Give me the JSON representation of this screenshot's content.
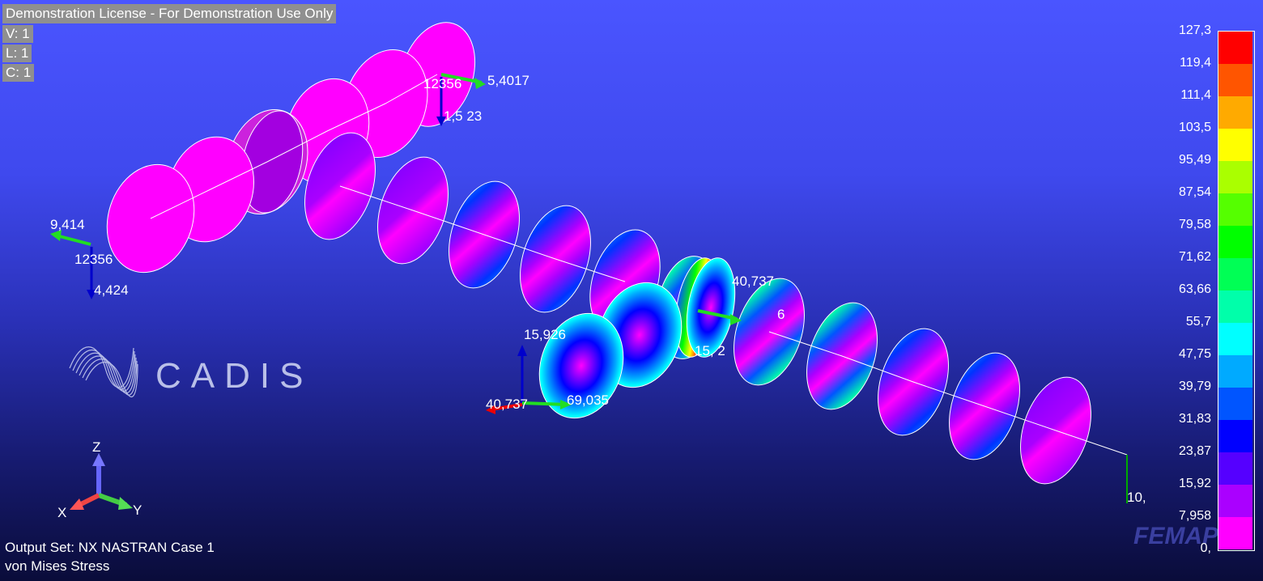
{
  "license": {
    "text": "Demonstration License - For Demonstration Use Only",
    "view": "V: 1",
    "layer": "L: 1",
    "color": "C: 1"
  },
  "output": {
    "set": "Output Set: NX NASTRAN Case 1",
    "quantity": "von Mises Stress"
  },
  "legend": {
    "labels": [
      "127,3",
      "119,4",
      "111,4",
      "103,5",
      "95,49",
      "87,54",
      "79,58",
      "71,62",
      "63,66",
      "55,7",
      "47,75",
      "39,79",
      "31,83",
      "23,87",
      "15,92",
      "7,958",
      "0,"
    ],
    "colors": [
      "#ff0000",
      "#ff5500",
      "#ffaa00",
      "#ffff00",
      "#aaff00",
      "#55ff00",
      "#00ff00",
      "#00ff55",
      "#00ffaa",
      "#00ffff",
      "#00aaff",
      "#0055ff",
      "#0000ff",
      "#5500ff",
      "#aa00ff",
      "#ff00ff"
    ]
  },
  "axes": {
    "z": "Z",
    "x": "X",
    "y": "Y"
  },
  "watermark": {
    "cadis": "CADIS",
    "femap": "FEMAP"
  },
  "scene_labels": {
    "node_top": "12356",
    "load_top": "5,4017",
    "load_top_2": "1,5 23",
    "load_left": "9,414",
    "node_left": "12356",
    "load_left_2": "4,424",
    "load_mid_1": "40,737",
    "load_mid_2": "15,926",
    "load_mid_3": "40,737",
    "load_mid_4": "69,035",
    "load_mid_5": "6",
    "load_mid_6": "15, 2",
    "load_right": "10,"
  },
  "colors": {
    "low": "#ff00ff",
    "mid": "#0055ff",
    "high": "#00ffaa"
  }
}
